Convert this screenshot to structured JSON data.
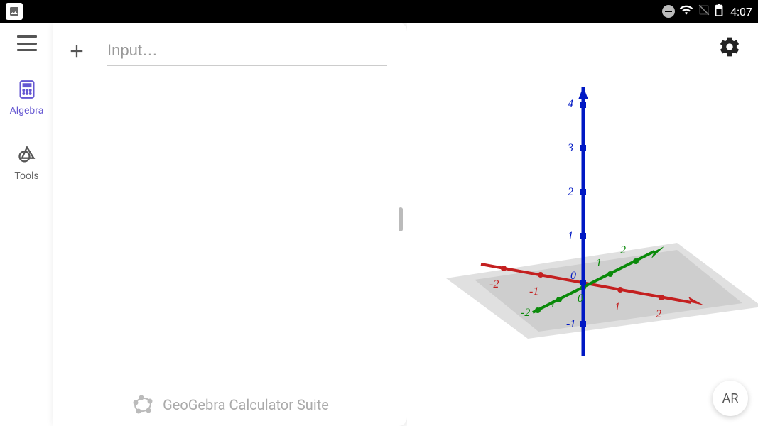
{
  "status": {
    "time": "4:07"
  },
  "sidebar": {
    "items": [
      {
        "id": "algebra",
        "label": "Algebra",
        "active": true
      },
      {
        "id": "tools",
        "label": "Tools",
        "active": false
      }
    ]
  },
  "input": {
    "placeholder": "Input…",
    "value": ""
  },
  "footer": {
    "brand": "GeoGebra Calculator Suite"
  },
  "ar_button": {
    "label": "AR"
  },
  "graph3d": {
    "axes": {
      "x": {
        "color": "#c42020",
        "ticks": [
          -2,
          -1,
          1,
          2
        ]
      },
      "y": {
        "color": "#0a8a0a",
        "ticks": [
          -2,
          -1,
          0,
          1,
          2
        ]
      },
      "z": {
        "color": "#0018c4",
        "ticks": [
          -1,
          0,
          1,
          2,
          3,
          4
        ]
      }
    }
  }
}
